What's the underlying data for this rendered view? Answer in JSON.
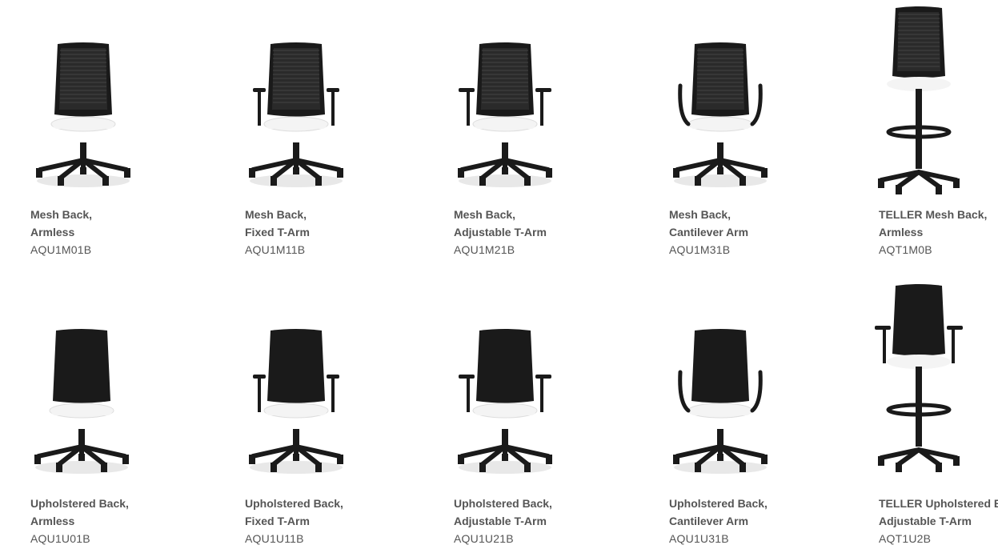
{
  "products": [
    {
      "name_line1": "Mesh Back,",
      "name_line2": "Armless",
      "code": "AQU1M01B",
      "back": "mesh",
      "arm": "none",
      "stool": false
    },
    {
      "name_line1": "Mesh Back,",
      "name_line2": "Fixed T-Arm",
      "code": "AQU1M11B",
      "back": "mesh",
      "arm": "fixed",
      "stool": false
    },
    {
      "name_line1": "Mesh Back,",
      "name_line2": "Adjustable T-Arm",
      "code": "AQU1M21B",
      "back": "mesh",
      "arm": "adjustable",
      "stool": false
    },
    {
      "name_line1": "Mesh Back,",
      "name_line2": "Cantilever Arm",
      "code": "AQU1M31B",
      "back": "mesh",
      "arm": "cantilever",
      "stool": false
    },
    {
      "name_line1": "TELLER Mesh Back,",
      "name_line2": "Armless",
      "code": "AQT1M0B",
      "back": "mesh",
      "arm": "none",
      "stool": true
    },
    {
      "name_line1": "Upholstered Back,",
      "name_line2": "Armless",
      "code": "AQU1U01B",
      "back": "upholstered",
      "arm": "none",
      "stool": false
    },
    {
      "name_line1": "Upholstered Back,",
      "name_line2": "Fixed T-Arm",
      "code": "AQU1U11B",
      "back": "upholstered",
      "arm": "fixed",
      "stool": false
    },
    {
      "name_line1": "Upholstered Back,",
      "name_line2": "Adjustable T-Arm",
      "code": "AQU1U21B",
      "back": "upholstered",
      "arm": "adjustable",
      "stool": false
    },
    {
      "name_line1": "Upholstered Back,",
      "name_line2": "Cantilever Arm",
      "code": "AQU1U31B",
      "back": "upholstered",
      "arm": "cantilever",
      "stool": false
    },
    {
      "name_line1": "TELLER Upholstered Back,",
      "name_line2": "Adjustable  T-Arm",
      "code": "AQT1U2B",
      "back": "upholstered",
      "arm": "adjustable",
      "stool": true
    }
  ],
  "colors": {
    "chair_frame": "#1a1a1a",
    "mesh_back": "#2a2a2a",
    "seat": "#f4f4f4",
    "caption_text": "#555555"
  }
}
